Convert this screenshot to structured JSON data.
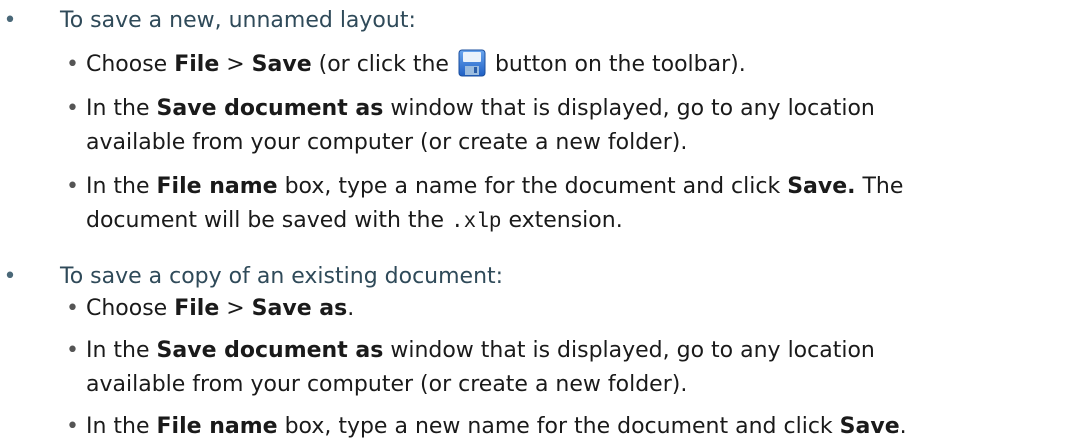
{
  "section1": {
    "bullet": "•",
    "heading": "To save a new, unnamed layout:",
    "step1": {
      "bullet": "•",
      "t1": "Choose ",
      "b1": "File",
      "t2": " > ",
      "b2": "Save",
      "t3": " (or click the ",
      "icon": "save-icon",
      "t4": " button on the toolbar)."
    },
    "step2": {
      "bullet": "•",
      "t1": "In the ",
      "b1": "Save document as",
      "t2": " window that is displayed, go to any location",
      "line2": "available from your computer (or create a new folder)."
    },
    "step3": {
      "bullet": "•",
      "t1": "In the ",
      "b1": "File name",
      "t2": " box, type a name for the document and click ",
      "b2": "Save.",
      "t3": " The",
      "line2a": "document will be saved with the ",
      "code": ".xlp",
      "line2b": " extension."
    }
  },
  "section2": {
    "bullet": "•",
    "heading": "To save a copy of an existing document:",
    "step1": {
      "bullet": "•",
      "t1": "Choose ",
      "b1": "File",
      "t2": " > ",
      "b2": "Save as",
      "t3": "."
    },
    "step2": {
      "bullet": "•",
      "t1": "In the ",
      "b1": "Save document as",
      "t2": " window that is displayed, go to any location",
      "line2": "available from your computer (or create a new folder)."
    },
    "step3": {
      "bullet": "•",
      "t1": "In the ",
      "b1": "File name",
      "t2": " box, type a new name for the document and click ",
      "b2": "Save",
      "t3": "."
    }
  },
  "colors": {
    "heading": "#2f4a59",
    "text": "#1a1a1a",
    "icon_blue": "#2f6fd0"
  }
}
